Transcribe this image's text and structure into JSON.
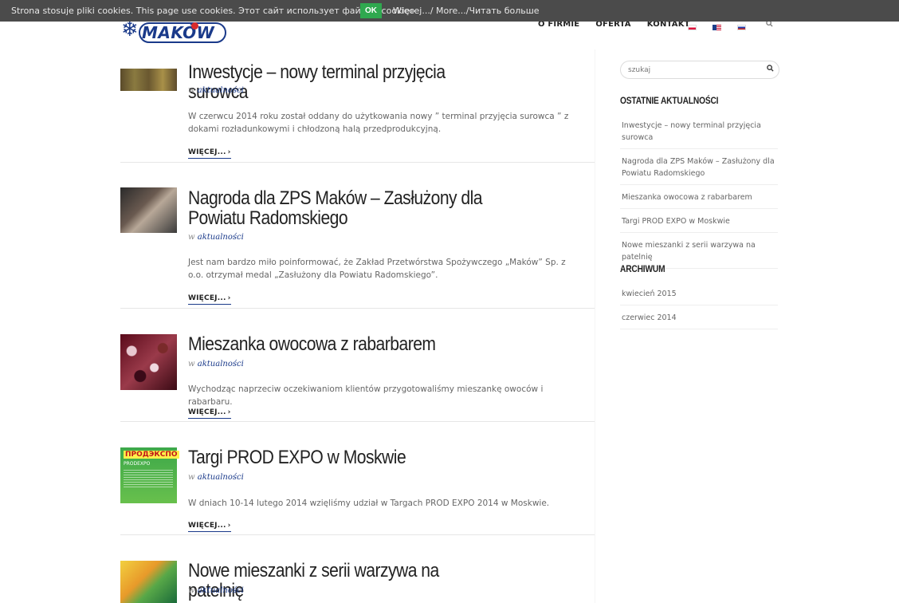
{
  "cookie": {
    "message": "Strona stosuje pliki cookies. This page use cookies. Этот сайт использует файлы «cookie»",
    "ok_label": "OK",
    "more_label": "Więcej.../ More.../Читать больше"
  },
  "header": {
    "logo_text": "MAKÓW",
    "nav": [
      "O FIRMIE",
      "OFERTA",
      "KONTAKT"
    ]
  },
  "posts": [
    {
      "title": "Inwestycje – nowy terminal przyjęcia surowca",
      "meta_prefix": "w",
      "category": "aktualności",
      "excerpt": "W czerwcu 2014 roku został oddany do użytkowania nowy ” terminal przyjęcia surowca ” z dokami rozładunkowymi i chłodzoną halą przedprodukcyjną.",
      "more": "WIĘCEJ..."
    },
    {
      "title": "Nagroda dla ZPS Maków – Zasłużony dla Powiatu Radomskiego",
      "meta_prefix": "w",
      "category": "aktualności",
      "excerpt": "Jest nam bardzo miło poinformować, że Zakład Przetwórstwa Spożywczego „Maków” Sp. z o.o. otrzymał medal „Zasłużony dla Powiatu Radomskiego”.",
      "more": "WIĘCEJ..."
    },
    {
      "title": "Mieszanka owocowa z rabarbarem",
      "meta_prefix": "w",
      "category": "aktualności",
      "excerpt": "Wychodząc naprzeciw oczekiwaniom klientów przygotowaliśmy mieszankę owoców i rabarbaru.",
      "more": "WIĘCEJ..."
    },
    {
      "title": "Targi PROD EXPO w Moskwie",
      "meta_prefix": "w",
      "category": "aktualności",
      "excerpt": "W dniach 10-14 lutego 2014 wzięliśmy udział w Targach PROD EXPO 2014 w Moskwie.",
      "more": "WIĘCEJ...",
      "thumb_text": "ПРОДЭКСПО",
      "thumb_sub": "PRODEXPO"
    },
    {
      "title": "Nowe mieszanki z serii warzywa na patelnię",
      "meta_prefix": "w",
      "category": "aktualności"
    }
  ],
  "sidebar": {
    "search_placeholder": "szukaj",
    "recent_title": "OSTATNIE AKTUALNOŚCI",
    "recent": [
      "Inwestycje – nowy terminal przyjęcia surowca",
      "Nagroda dla ZPS Maków – Zasłużony dla Powiatu Radomskiego",
      "Mieszanka owocowa z rabarbarem",
      "Targi PROD EXPO w Moskwie",
      "Nowe mieszanki z serii warzywa na patelnię"
    ],
    "archive_title": "ARCHIWUM",
    "archive": [
      "kwiecień 2015",
      "czerwiec 2014"
    ]
  }
}
